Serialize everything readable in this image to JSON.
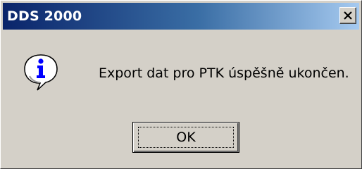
{
  "window": {
    "title": "DDS 2000",
    "close_icon": "close-icon"
  },
  "dialog": {
    "icon": "info-icon",
    "message": "Export dat pro PTK úspěšně ukončen.",
    "ok_label": "OK"
  },
  "colors": {
    "titlebar_start": "#0a246a",
    "titlebar_end": "#a6caf0",
    "face": "#d4d0c8",
    "icon_blue": "#0000ff"
  }
}
